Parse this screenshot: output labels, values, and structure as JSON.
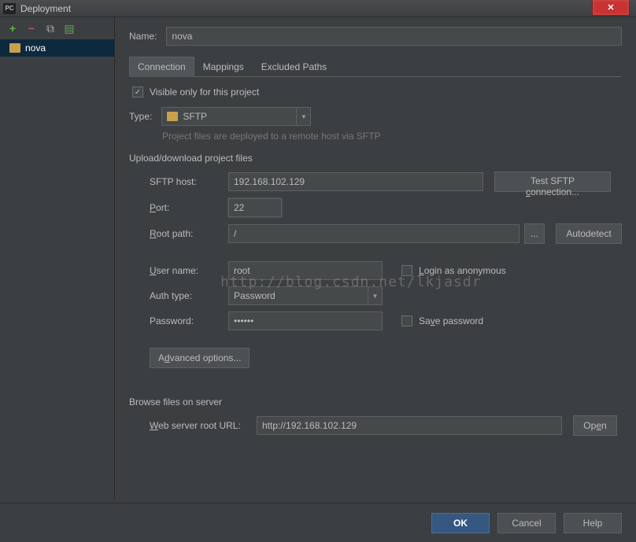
{
  "titlebar": {
    "icon": "PC",
    "title": "Deployment"
  },
  "sidebar": {
    "items": [
      {
        "label": "nova"
      }
    ]
  },
  "name": {
    "label": "Name:",
    "value": "nova"
  },
  "tabs": {
    "connection": "Connection",
    "mappings": "Mappings",
    "excluded": "Excluded Paths"
  },
  "visible_checkbox": {
    "checked": "✓",
    "label": "Visible only for this project"
  },
  "type": {
    "label": "Type:",
    "value": "SFTP",
    "hint": "Project files are deployed to a remote host via SFTP"
  },
  "section1": {
    "title": "Upload/download project files",
    "sftp_host": {
      "label": "SFTP host:",
      "value": "192.168.102.129"
    },
    "test_btn": "Test SFTP connection...",
    "port": {
      "label": "Port:",
      "value": "22",
      "accel": "P"
    },
    "root_path": {
      "label": "Root path:",
      "value": "/",
      "accel": "R",
      "browse": "...",
      "autodetect": "Autodetect"
    },
    "user": {
      "label": "User name:",
      "value": "root",
      "accel": "U",
      "anon": "Login as anonymous",
      "anon_accel": "L"
    },
    "auth": {
      "label": "Auth type:",
      "value": "Password"
    },
    "password": {
      "label": "Password:",
      "value": "••••••",
      "save": "Save password",
      "save_accel": "v"
    },
    "advanced": "Advanced options...",
    "advanced_accel": "d"
  },
  "section2": {
    "title": "Browse files on server",
    "web_url": {
      "label": "Web server root URL:",
      "value": "http://192.168.102.129",
      "accel": "W"
    },
    "open": "Open",
    "open_accel": "e"
  },
  "footer": {
    "ok": "OK",
    "cancel": "Cancel",
    "help": "Help"
  },
  "watermark": "http://blog.csdn.net/lkjasdr"
}
